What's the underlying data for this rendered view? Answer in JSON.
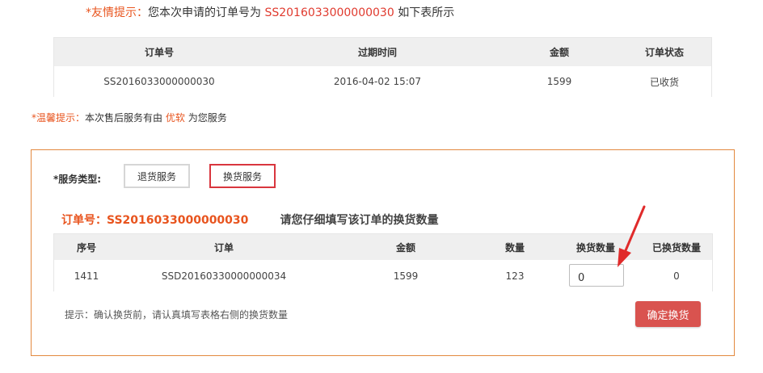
{
  "top_tip": {
    "prefix": "*友情提示：",
    "text": "您本次申请的订单号为",
    "order_no": "SS2016033000000030",
    "suffix": "如下表所示"
  },
  "order_table": {
    "headers": [
      "订单号",
      "过期时间",
      "金额",
      "订单状态"
    ],
    "row": [
      "SS2016033000000030",
      "2016-04-02 15:07",
      "1599",
      "已收货"
    ]
  },
  "warm_tip": {
    "prefix": "*温馨提示：",
    "text": "本次售后服务有由",
    "provider": "优软",
    "suffix": "为您服务"
  },
  "service": {
    "type_label": "*服务类型:",
    "return_label": "退货服务",
    "exchange_label": "换货服务",
    "order_label": "订单号：SS2016033000000030",
    "hint_title": "请您仔细填写该订单的换货数量"
  },
  "exchange_table": {
    "headers": [
      "序号",
      "订单",
      "金额",
      "数量",
      "换货数量",
      "已换货数量"
    ],
    "row": {
      "seq": "1411",
      "order": "SSD20160330000000034",
      "amount": "1599",
      "quantity": "123",
      "exchange_qty": "0",
      "exchanged_qty": "0"
    }
  },
  "bottom_hint": "提示：确认换货前，请认真填写表格右侧的换货数量",
  "confirm_button": "确定换货",
  "colors": {
    "accent_orange": "#e8541e",
    "panel_border": "#e3893f",
    "button_red": "#d9534f",
    "arrow_red": "#e02b2b"
  }
}
